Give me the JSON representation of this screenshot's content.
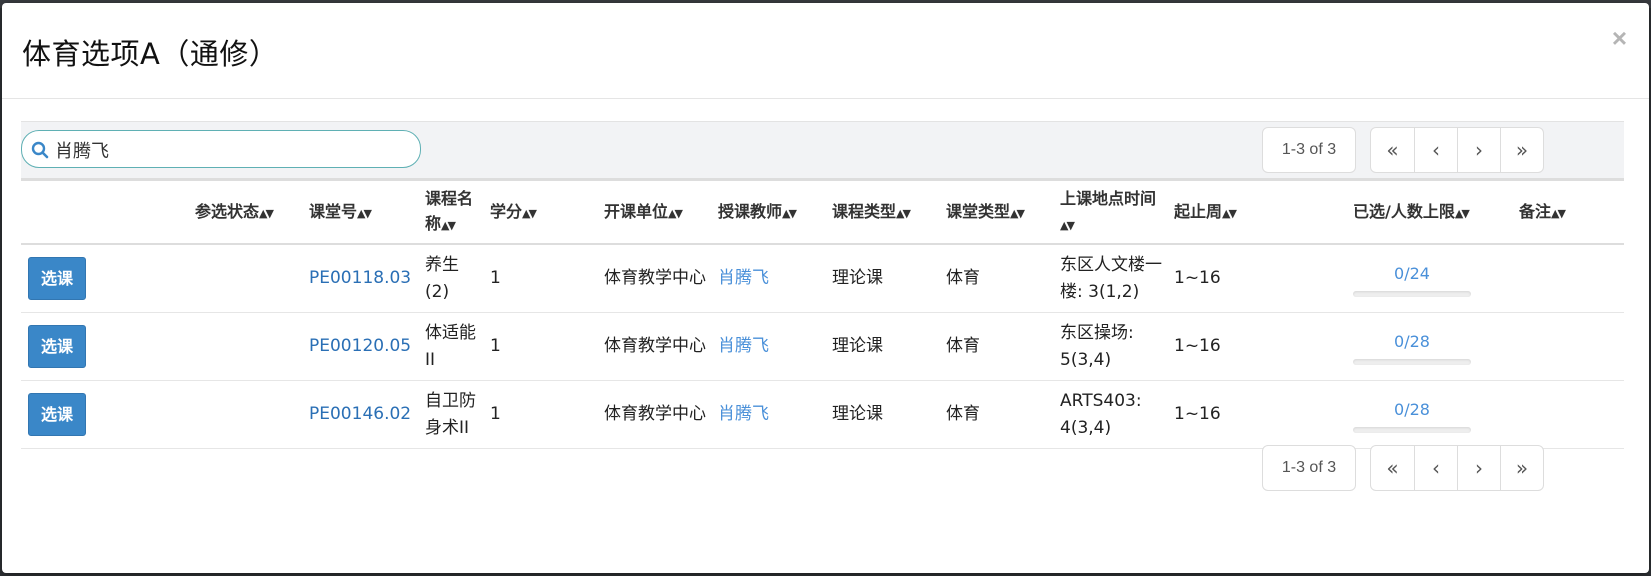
{
  "modal": {
    "title": "体育选项A（通修）",
    "close_label": "×"
  },
  "search": {
    "value": "肖腾飞"
  },
  "pagination": {
    "info": "1-3 of 3",
    "first": "«",
    "prev": "‹",
    "next": "›",
    "last": "»"
  },
  "table": {
    "headers": {
      "status": "参选状态",
      "class_no": "课堂号",
      "course_name": "课程名称",
      "credits": "学分",
      "department": "开课单位",
      "teacher": "授课教师",
      "course_type": "课程类型",
      "class_type": "课堂类型",
      "location_time": "上课地点时间",
      "weeks": "起止周",
      "enrollment": "已选/人数上限",
      "notes": "备注"
    },
    "rows": [
      {
        "action": "选课",
        "class_no": "PE00118.03",
        "course_name": "养生(2)",
        "credits": "1",
        "department": "体育教学中心",
        "teacher": "肖腾飞",
        "course_type": "理论课",
        "class_type": "体育",
        "location_time": "东区人文楼一楼: 3(1,2)",
        "weeks": "1~16",
        "enrollment": "0/24",
        "enrollment_fraction": 0,
        "notes": ""
      },
      {
        "action": "选课",
        "class_no": "PE00120.05",
        "course_name": "体适能II",
        "credits": "1",
        "department": "体育教学中心",
        "teacher": "肖腾飞",
        "course_type": "理论课",
        "class_type": "体育",
        "location_time": "东区操场: 5(3,4)",
        "weeks": "1~16",
        "enrollment": "0/28",
        "enrollment_fraction": 0,
        "notes": ""
      },
      {
        "action": "选课",
        "class_no": "PE00146.02",
        "course_name": "自卫防身术II",
        "credits": "1",
        "department": "体育教学中心",
        "teacher": "肖腾飞",
        "course_type": "理论课",
        "class_type": "体育",
        "location_time": "ARTS403: 4(3,4)",
        "weeks": "1~16",
        "enrollment": "0/28",
        "enrollment_fraction": 0,
        "notes": ""
      }
    ]
  },
  "colors": {
    "primary_button": "#3a87c8",
    "link": "#2a6fb5",
    "search_border": "#5fb0b4"
  }
}
